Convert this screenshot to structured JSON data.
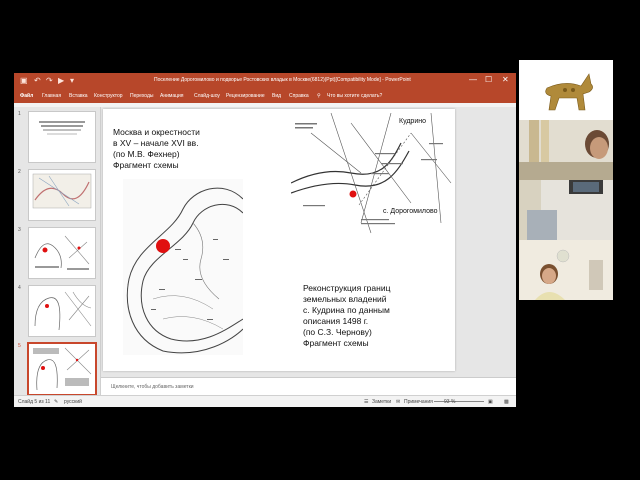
{
  "window": {
    "title": "Поселение Дорогомилово и подворье Ростовских владык в Москве(6812)(Ppt)[Compatibility Mode] - PowerPoint",
    "controls": [
      "—",
      "☐",
      "✕"
    ]
  },
  "ribbon": {
    "file": "Файл",
    "tabs": [
      "Главная",
      "Вставка",
      "Конструктор",
      "Переходы",
      "Анимация",
      "Слайд-шоу",
      "Рецензирование",
      "Вид",
      "Справка"
    ],
    "tell_me": "Что вы хотите сделать?"
  },
  "thumbnails": [
    {
      "num": "1",
      "selected": false
    },
    {
      "num": "2",
      "selected": false
    },
    {
      "num": "3",
      "selected": false
    },
    {
      "num": "4",
      "selected": false
    },
    {
      "num": "5",
      "selected": true
    }
  ],
  "slide": {
    "left_caption": [
      "Москва и окрестности",
      "в XV – начале XVI вв.",
      "(по М.В. Фехнер)",
      "Фрагмент схемы"
    ],
    "right_caption": [
      "Реконструкция границ",
      "земельных владений",
      "с. Кудрина по данным",
      "описания 1498 г.",
      "(по С.З. Чернову)",
      "Фрагмент схемы"
    ],
    "map_labels": {
      "kudrino": "Кудрино",
      "dorogomilovo": "с. Дорогомилово"
    },
    "marker_color": "#e01010"
  },
  "notes": {
    "placeholder": "Щелкните, чтобы добавить заметки"
  },
  "status": {
    "slide_info": "Слайд 5 из 11",
    "language": "русский",
    "notes_btn": "Заметки",
    "comments_btn": "Примечания",
    "zoom": "93 %"
  },
  "colors": {
    "accent": "#b7472a"
  }
}
